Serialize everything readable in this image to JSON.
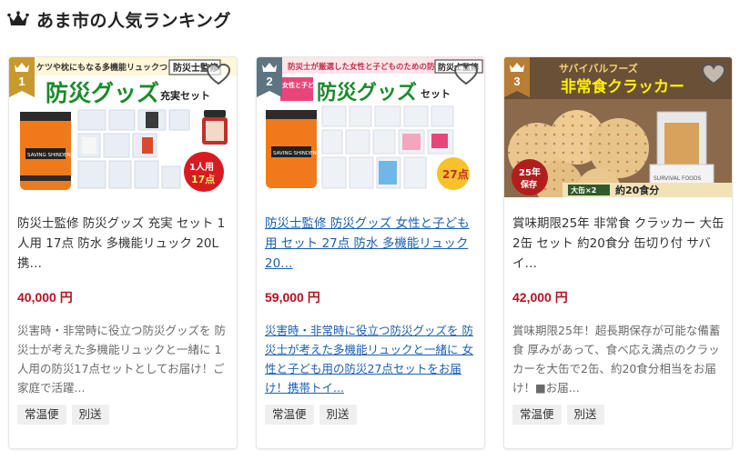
{
  "header": {
    "title": "あま市の人気ランキング",
    "icon": "crown-icon"
  },
  "colors": {
    "gold": "#c69a2e",
    "silver": "#5e7480",
    "bronze": "#b87d36",
    "price": "#b3121e",
    "link": "#1a5fb4"
  },
  "products": [
    {
      "rank": "1",
      "name": "防災士監修 防災グッズ 充実 セット 1人用 17点 防水 多機能リュック 20L 携…",
      "price": "40,000 円",
      "description": "災害時・非常時に役立つ防災グッズを 防災士が考えた多機能リュックと一緒に 1人用の防災17点セットとしてお届け！ご家庭で活躍...",
      "tags": [
        "常温便",
        "別送"
      ],
      "image": {
        "top_text": "ケツや枕にもなる多機能リュックつき",
        "supervisor": "防災士監修",
        "headline": "防災グッズ",
        "headline_suffix": "充実セット",
        "bag_label": "SAVING SHINDENSHA",
        "burst": "1人用",
        "burst_count": "17点"
      }
    },
    {
      "rank": "2",
      "name": "防災士監修 防災グッズ 女性と子ども用 セット 27点 防水 多機能リュック 20…",
      "price": "59,000 円",
      "description": "災害時・非常時に役立つ防災グッズを 防災士が考えた多機能リュックと一緒に 女性と子ども用の防災27点セットをお届け！携帯トイ...",
      "tags": [
        "常温便",
        "別送"
      ],
      "image": {
        "top_text": "防災士が厳選した女性と子どものための防災用品",
        "supervisor": "防災士監修",
        "side_text": "女性と子ども用",
        "headline": "防災グッズ",
        "headline_suffix": "セット",
        "bag_label": "SAVING SHINDENSHA",
        "burst_count": "27点"
      }
    },
    {
      "rank": "3",
      "name": "賞味期限25年 非常食 クラッカー 大缶2缶 セット 約20食分 缶切り付 サバイ…",
      "price": "42,000 円",
      "description": "賞味期限25年！超長期保存が可能な備蓄食 厚みがあって、食べ応え満点のクラッカーを大缶で2缶、約20食分相当をお届け！■お届...",
      "tags": [
        "常温便",
        "別送"
      ],
      "image": {
        "brand_top": "サバイバルフーズ",
        "headline": "非常食クラッカー",
        "badge_top": "25年",
        "badge_bottom": "保存",
        "strip_can": "大缶×2",
        "strip_meals": "約20食分",
        "can_label": "SURVIVAL FOODS"
      }
    }
  ]
}
